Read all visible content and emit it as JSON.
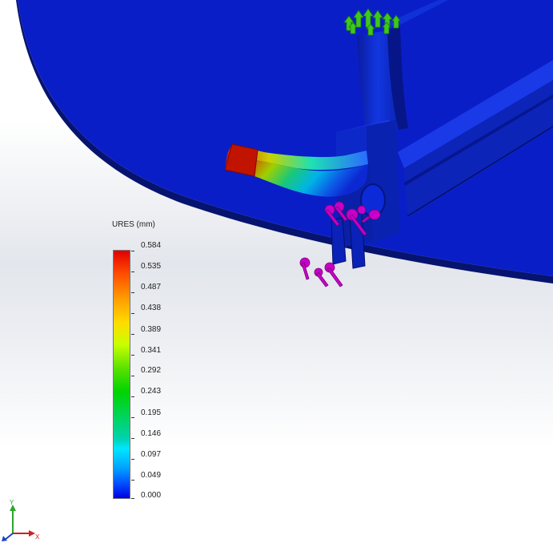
{
  "legend": {
    "title": "URES (mm)",
    "values": [
      "0.584",
      "0.535",
      "0.487",
      "0.438",
      "0.389",
      "0.341",
      "0.292",
      "0.243",
      "0.195",
      "0.146",
      "0.097",
      "0.049",
      "0.000"
    ]
  },
  "triad": {
    "x_label": "X",
    "y_label": "Y"
  },
  "colors": {
    "model_blue": "#0a21c8",
    "fixture_green": "#3ec81e",
    "load_magenta": "#c800c8",
    "max_red": "#c81400"
  }
}
